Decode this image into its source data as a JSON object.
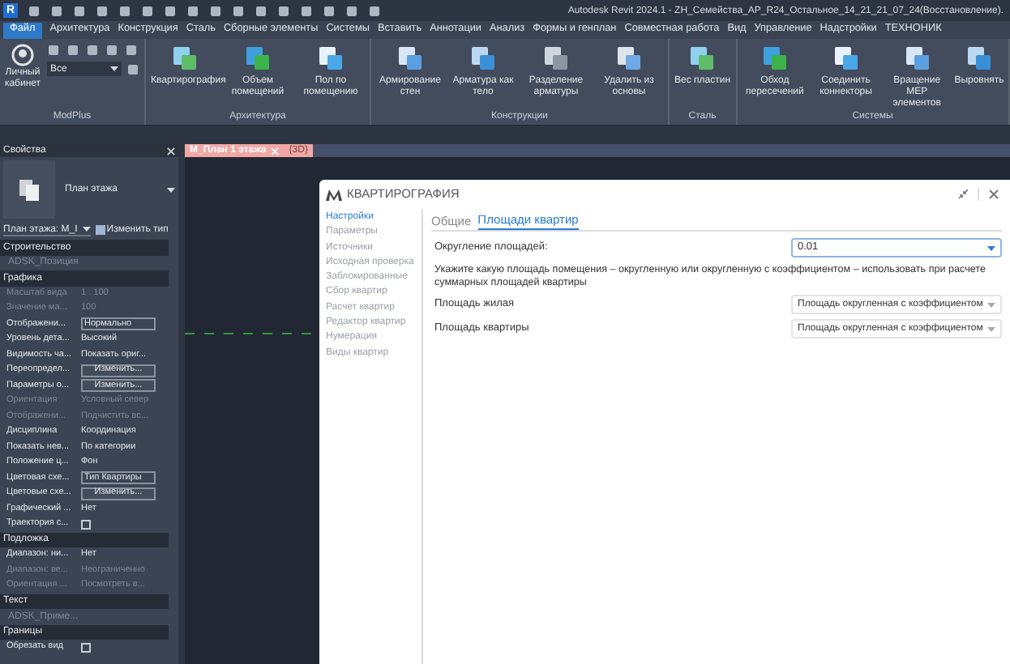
{
  "app_logo": "R",
  "window": {
    "title": "Autodesk Revit 2024.1 - ZH_Семейства_АР_R24_Остальное_14_21_21_07_24(Восстановление)."
  },
  "menu_tabs": [
    {
      "label": "Файл",
      "selected": true
    },
    {
      "label": "Архитектура",
      "selected": false
    },
    {
      "label": "Конструкция",
      "selected": false
    },
    {
      "label": "Сталь",
      "selected": false
    },
    {
      "label": "Сборные элементы",
      "selected": false
    },
    {
      "label": "Системы",
      "selected": false
    },
    {
      "label": "Вставить",
      "selected": false
    },
    {
      "label": "Аннотации",
      "selected": false
    },
    {
      "label": "Анализ",
      "selected": false
    },
    {
      "label": "Формы и генплан",
      "selected": false
    },
    {
      "label": "Совместная работа",
      "selected": false
    },
    {
      "label": "Вид",
      "selected": false
    },
    {
      "label": "Управление",
      "selected": false
    },
    {
      "label": "Надстройки",
      "selected": false
    },
    {
      "label": "ТЕХНОНИК",
      "selected": false
    }
  ],
  "ribbon": {
    "modplus": {
      "title": "ModPlus",
      "account": "Личный кабинет",
      "filter": "Все"
    },
    "panels": [
      {
        "title": "Архитектура",
        "buttons": [
          "Квартирография",
          "Объем помещений",
          "Пол по помещению"
        ]
      },
      {
        "title": "Конструкции",
        "buttons": [
          "Армирование стен",
          "Арматура как тело",
          "Разделение арматуры",
          "Удалить из основы"
        ]
      },
      {
        "title": "Сталь",
        "buttons": [
          "Вес пластин"
        ]
      },
      {
        "title": "Системы",
        "buttons": [
          "Обход пересечений",
          "Соединить коннекторы",
          "Вращение MEP элементов",
          "Выровнять"
        ]
      }
    ]
  },
  "properties": {
    "title": "Свойства",
    "type_name": "План этажа",
    "view_selector": "План этажа: M_I",
    "edit_type": "Изменить тип",
    "sections": [
      {
        "title": "Строительство",
        "rows": [
          {
            "label": "ADSK_Позиция",
            "kind": "full",
            "disabled": true
          }
        ]
      },
      {
        "title": "Графика",
        "rows": [
          {
            "label": "Масштаб вида",
            "value": "1 : 100",
            "kind": "text",
            "disabled": true
          },
          {
            "label": "Значение ма...",
            "value": "100",
            "kind": "text",
            "disabled": true
          },
          {
            "label": "Отображени...",
            "value": "Нормально",
            "kind": "field",
            "disabled": false
          },
          {
            "label": "Уровень дета...",
            "value": "Высокий",
            "kind": "text",
            "disabled": false
          },
          {
            "label": "Видимость ча...",
            "value": "Показать ориг...",
            "kind": "text",
            "disabled": false
          },
          {
            "label": "Переопредел...",
            "value": "Изменить...",
            "kind": "button",
            "disabled": false
          },
          {
            "label": "Параметры о...",
            "value": "Изменить...",
            "kind": "button",
            "disabled": false
          },
          {
            "label": "Ориентация",
            "value": "Условный север",
            "kind": "text",
            "disabled": true
          },
          {
            "label": "Отображени...",
            "value": "Подчистить вс...",
            "kind": "text",
            "disabled": true
          },
          {
            "label": "Дисциплина",
            "value": "Координация",
            "kind": "text",
            "disabled": false
          },
          {
            "label": "Показать нев...",
            "value": "По категории",
            "kind": "text",
            "disabled": false
          },
          {
            "label": "Положение ц...",
            "value": "Фон",
            "kind": "text",
            "disabled": false
          },
          {
            "label": "Цветовая схе...",
            "value": "Тип Квартиры",
            "kind": "field",
            "disabled": false
          },
          {
            "label": "Цветовые схе...",
            "value": "Изменить...",
            "kind": "button",
            "disabled": false
          },
          {
            "label": "Графический ...",
            "value": "Нет",
            "kind": "text",
            "disabled": false
          },
          {
            "label": "Траектория с...",
            "kind": "checkbox",
            "checked": false,
            "disabled": false
          }
        ]
      },
      {
        "title": "Подложка",
        "rows": [
          {
            "label": "Диапазон: ни...",
            "value": "Нет",
            "kind": "text",
            "disabled": false
          },
          {
            "label": "Диапазон: ве...",
            "value": "Неограниченно",
            "kind": "text",
            "disabled": true
          },
          {
            "label": "Ориентация ...",
            "value": "Посмотреть в...",
            "kind": "text",
            "disabled": true
          }
        ]
      },
      {
        "title": "Текст",
        "rows": [
          {
            "label": "ADSK_Приме...",
            "kind": "full",
            "disabled": true
          }
        ]
      },
      {
        "title": "Границы",
        "rows": [
          {
            "label": "Обрезать вид",
            "kind": "checkbox",
            "checked": false,
            "disabled": false
          }
        ]
      }
    ]
  },
  "view_tabs": [
    {
      "label": "M_План 1 этажа",
      "selected": true
    },
    {
      "label": "{3D}",
      "selected": false
    }
  ],
  "dialog": {
    "title": "КВАРТИРОГРАФИЯ",
    "nav": [
      {
        "label": "Настройки",
        "selected": true
      },
      {
        "label": "Параметры",
        "selected": false
      },
      {
        "label": "Источники",
        "selected": false
      },
      {
        "label": "Исходная проверка",
        "selected": false
      },
      {
        "label": "Заблокированные",
        "selected": false
      },
      {
        "label": "Сбор квартир",
        "selected": false
      },
      {
        "label": "Расчет квартир",
        "selected": false
      },
      {
        "label": "Редактор квартир",
        "selected": false
      },
      {
        "label": "Нумерация",
        "selected": false
      },
      {
        "label": "Виды квартир",
        "selected": false
      }
    ],
    "tabs": [
      {
        "label": "Общие",
        "selected": false
      },
      {
        "label": "Площади квартир",
        "selected": true
      }
    ],
    "rounding": {
      "label": "Округление площадей:",
      "value": "0.01"
    },
    "hint": "Укажите какую площадь помещения – округленную или округленную с коэффициентом – использовать при расчете суммарных площадей квартиры",
    "fields": [
      {
        "label": "Площадь жилая",
        "value": "Площадь округленная с коэффициентом"
      },
      {
        "label": "Площадь квартиры",
        "value": "Площадь округленная с коэффициентом"
      }
    ]
  }
}
